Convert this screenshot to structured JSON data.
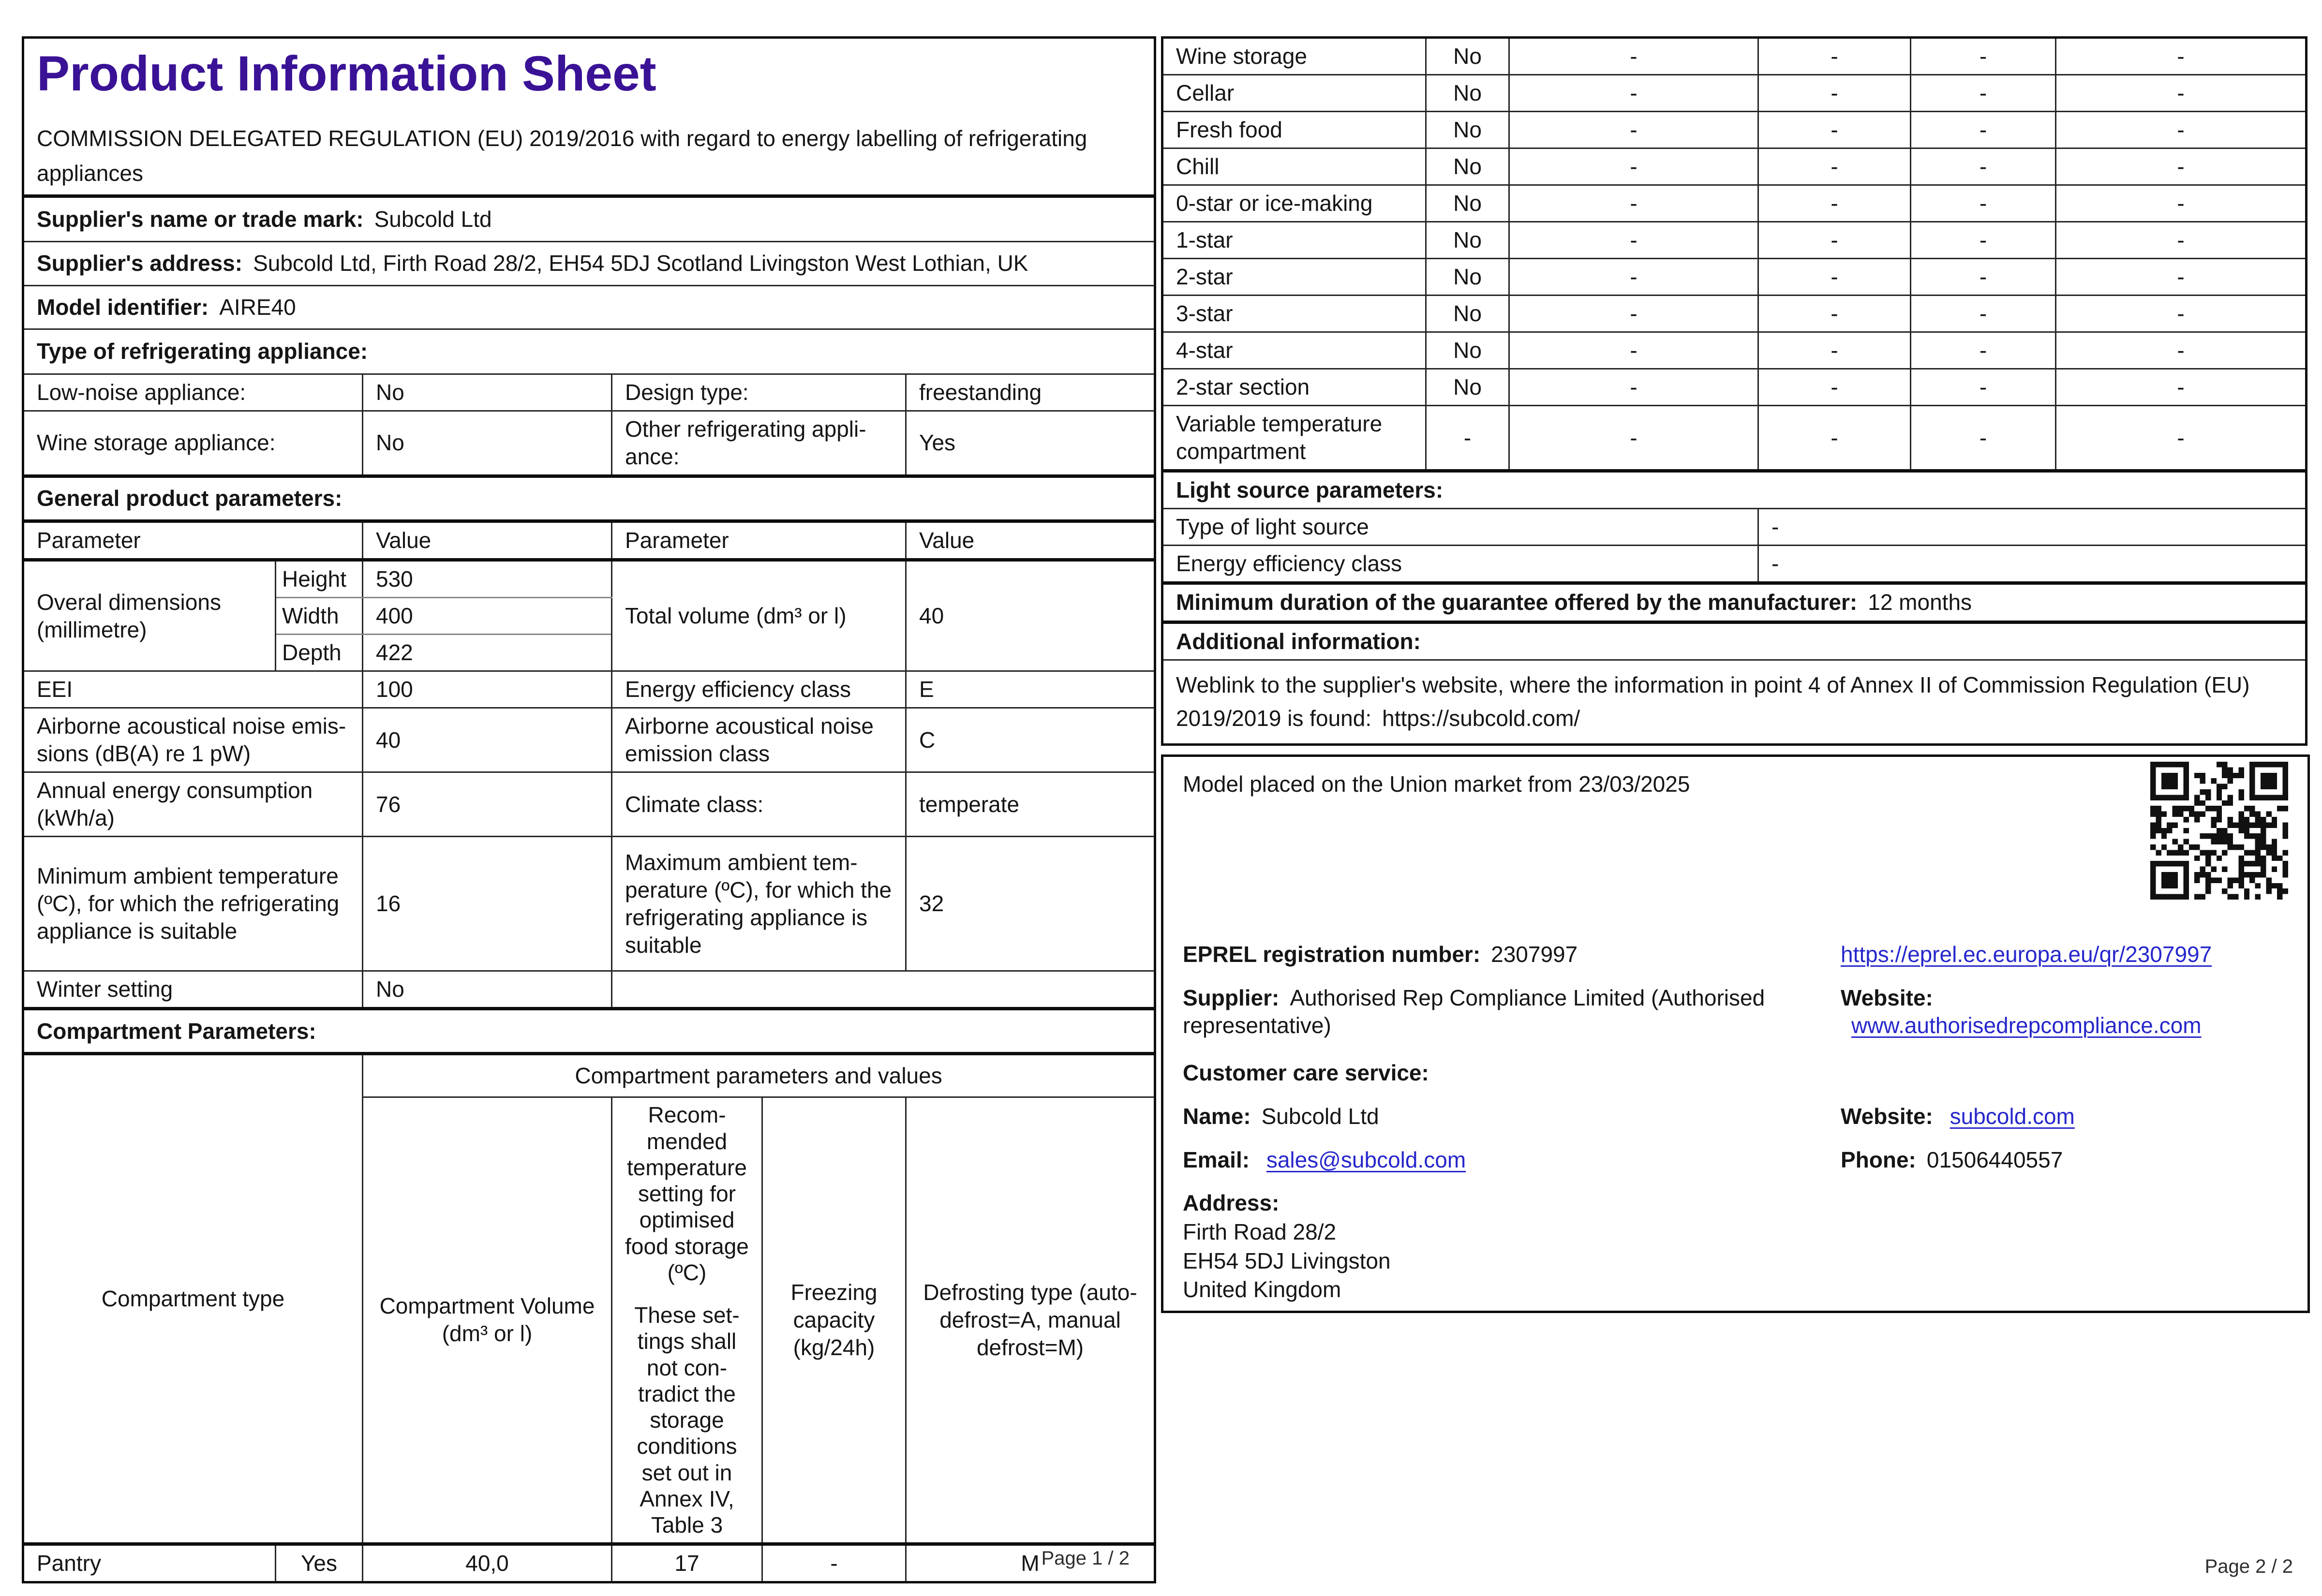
{
  "page1": {
    "title": "Product Information Sheet",
    "regulation": "COMMISSION DELEGATED REGULATION (EU) 2019/2016 with regard to energy labelling of refrigerating appliances",
    "supplier_name": {
      "label": "Supplier's name or trade mark:",
      "value": "Subcold Ltd"
    },
    "supplier_address": {
      "label": "Supplier's address:",
      "value": "Subcold Ltd, Firth Road 28/2, EH54 5DJ Scotland Livingston West Lothian, UK"
    },
    "model_identifier": {
      "label": "Model identifier:",
      "value": "AIRE40"
    },
    "type_section": "Type of refrigerating appliance:",
    "low_noise": {
      "label": "Low-noise appliance:",
      "value": "No"
    },
    "design_type": {
      "label": "Design type:",
      "value": "freestanding"
    },
    "wine_storage": {
      "label": "Wine storage appliance:",
      "value": "No"
    },
    "other_appliance": {
      "label": "Other refrigerating appli­ance:",
      "value": "Yes"
    },
    "general_section": "General product parameters:",
    "col_headers": {
      "param1": "Parameter",
      "value1": "Value",
      "param2": "Parameter",
      "value2": "Value"
    },
    "dimensions": {
      "label": "Overal dimensions (millimetre)",
      "height_label": "Height",
      "height": "530",
      "width_label": "Width",
      "width": "400",
      "depth_label": "Depth",
      "depth": "422"
    },
    "total_volume": {
      "label": "Total volume (dm³ or l)",
      "value": "40"
    },
    "eei": {
      "label": "EEI",
      "value": "100"
    },
    "energy_class": {
      "label": "Energy efficiency class",
      "value": "E"
    },
    "noise": {
      "label": "Airborne acoustical noise emis­sions (dB(A) re 1 pW)",
      "value": "40"
    },
    "noise_class": {
      "label": "Airborne acoustical noise emission class",
      "value": "C"
    },
    "annual_energy": {
      "label": "Annual energy consumption (kWh/a)",
      "value": "76"
    },
    "climate_class": {
      "label": "Climate class:",
      "value": "temperate"
    },
    "min_ambient": {
      "label": "Minimum ambient tempera­ture (ºC), for which the refrig­erating appliance is suitable",
      "value": "16"
    },
    "max_ambient": {
      "label": "Maximum ambient tem­perature (ºC), for which the refrigerating appliance is suitable",
      "value": "32"
    },
    "winter_setting": {
      "label": "Winter setting",
      "value": "No"
    },
    "compartment_section": "Compartment Parameters:",
    "compartment_table": {
      "col_type": "Compartment type",
      "col_group": "Compartment parameters and values",
      "col_volume": "Compartment Vol­ume (dm³ or l)",
      "col_temp_1": "Recom­mended tempera­ture setting for opti­mised food storage (ºC)",
      "col_temp_2": "These set­tings shall not con­tradict the storage conditions set out in Annex IV, Table 3",
      "col_freezing": "Freezing capacity (kg/24h)",
      "col_defrost": "Defrosting type (auto-defrost=A, manual defrost=M)",
      "row": {
        "type": "Pantry",
        "present": "Yes",
        "volume": "40,0",
        "temp": "17",
        "freezing": "-",
        "defrost": "M"
      }
    },
    "footer": "Page 1 / 2"
  },
  "page2": {
    "compartment_rows": [
      {
        "label": "Wine storage",
        "c1": "No",
        "c2": "-",
        "c3": "-",
        "c4": "-",
        "c5": "-"
      },
      {
        "label": "Cellar",
        "c1": "No",
        "c2": "-",
        "c3": "-",
        "c4": "-",
        "c5": "-"
      },
      {
        "label": "Fresh food",
        "c1": "No",
        "c2": "-",
        "c3": "-",
        "c4": "-",
        "c5": "-"
      },
      {
        "label": "Chill",
        "c1": "No",
        "c2": "-",
        "c3": "-",
        "c4": "-",
        "c5": "-"
      },
      {
        "label": "0-star or ice-making",
        "c1": "No",
        "c2": "-",
        "c3": "-",
        "c4": "-",
        "c5": "-"
      },
      {
        "label": "1-star",
        "c1": "No",
        "c2": "-",
        "c3": "-",
        "c4": "-",
        "c5": "-"
      },
      {
        "label": "2-star",
        "c1": "No",
        "c2": "-",
        "c3": "-",
        "c4": "-",
        "c5": "-"
      },
      {
        "label": "3-star",
        "c1": "No",
        "c2": "-",
        "c3": "-",
        "c4": "-",
        "c5": "-"
      },
      {
        "label": "4-star",
        "c1": "No",
        "c2": "-",
        "c3": "-",
        "c4": "-",
        "c5": "-"
      },
      {
        "label": "2-star section",
        "c1": "No",
        "c2": "-",
        "c3": "-",
        "c4": "-",
        "c5": "-"
      },
      {
        "label": "Variable temperature compartment",
        "c1": "-",
        "c2": "-",
        "c3": "-",
        "c4": "-",
        "c5": "-"
      }
    ],
    "light_section": "Light source parameters:",
    "light_type": {
      "label": "Type of light source",
      "value": "-"
    },
    "light_class": {
      "label": "Energy efficiency class",
      "value": "-"
    },
    "guarantee": {
      "label": "Minimum duration of the guarantee offered by the manufacturer:",
      "value": "12 months"
    },
    "additional_section": "Additional information:",
    "weblink": {
      "text": "Weblink to the supplier's website, where the information in point 4 of Annex II of Commission Regulation (EU) 2019/2019 is found:",
      "url": "https://subcold.com/"
    },
    "market_text": "Model placed on the Union market from 23/03/2025",
    "qr_icon": "qr-code",
    "eprel": {
      "label": "EPREL registration number:",
      "value": "2307997",
      "link": "https://eprel.ec.europa.eu/qr/2307997"
    },
    "supplier": {
      "label": "Supplier:",
      "value": "Authorised Rep Compliance Limited (Authorised representative)"
    },
    "website1": {
      "label": "Website:",
      "link": "www.authorisedrepcompliance.com"
    },
    "care_section": "Customer care service:",
    "care_name": {
      "label": "Name:",
      "value": "Subcold Ltd"
    },
    "website2": {
      "label": "Website:",
      "link": "subcold.com"
    },
    "email": {
      "label": "Email:",
      "link": "sales@subcold.com"
    },
    "phone": {
      "label": "Phone:",
      "value": "01506440557"
    },
    "address": {
      "label": "Address:",
      "lines": [
        "Firth Road 28/2",
        " EH54 5DJ Livingston",
        "United Kingdom"
      ]
    },
    "footer": "Page 2 / 2"
  }
}
